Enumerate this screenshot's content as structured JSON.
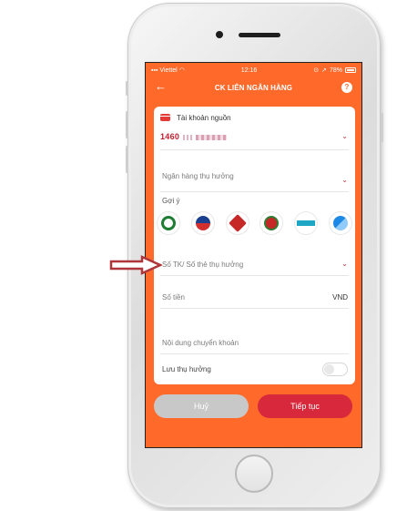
{
  "status_bar": {
    "carrier": "Viettel",
    "time": "12:16",
    "battery": "78%"
  },
  "header": {
    "title": "CK LIÊN NGÂN HÀNG",
    "back_icon": "back-arrow-icon",
    "help_icon": "question-icon",
    "help_label": "?"
  },
  "source_account": {
    "title": "Tài khoản nguồn",
    "number": "1460"
  },
  "form": {
    "beneficiary_bank_placeholder": "Ngân hàng thụ hưởng",
    "suggestions_label": "Gợi ý",
    "account_placeholder": "Số TK/ Số thẻ thụ hưởng",
    "amount_placeholder": "Số tiền",
    "currency": "VND",
    "content_placeholder": "Nội dung chuyển khoản",
    "save_beneficiary_label": "Lưu thụ hưởng",
    "save_beneficiary_on": false
  },
  "suggested_banks": [
    "bank-1-icon",
    "bank-2-icon",
    "bank-3-icon",
    "bank-4-icon",
    "bank-5-icon",
    "bank-6-icon"
  ],
  "buttons": {
    "cancel": "Huỷ",
    "continue": "Tiếp tục"
  },
  "colors": {
    "accent": "#ff6a2b",
    "primary_button": "#d8283c",
    "annotation_arrow": "#b0353a"
  }
}
